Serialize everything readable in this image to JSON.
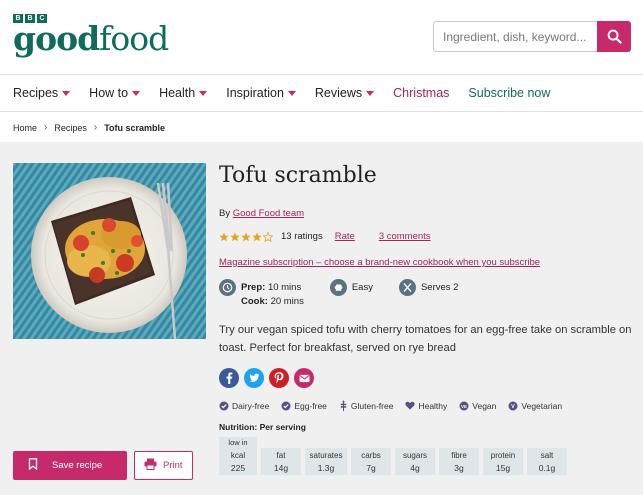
{
  "brand": {
    "bbc_letters": [
      "B",
      "B",
      "C"
    ],
    "name_bold": "good",
    "name_regular": "food",
    "accent": "#c72a6b",
    "brand_green": "#0f6b5c"
  },
  "search": {
    "placeholder": "Ingredient, dish, keyword...",
    "icon": "search-icon"
  },
  "nav": {
    "items": [
      {
        "label": "Recipes",
        "dropdown": true
      },
      {
        "label": "How to",
        "dropdown": true
      },
      {
        "label": "Health",
        "dropdown": true
      },
      {
        "label": "Inspiration",
        "dropdown": true
      },
      {
        "label": "Reviews",
        "dropdown": true
      },
      {
        "label": "Christmas",
        "dropdown": false
      },
      {
        "label": "Subscribe now",
        "dropdown": false
      }
    ]
  },
  "breadcrumb": {
    "items": [
      "Home",
      "Recipes",
      "Tofu scramble"
    ],
    "separator": "›"
  },
  "recipe": {
    "title": "Tofu scramble",
    "by_prefix": "By",
    "author": "Good Food team",
    "rating_stars": 4,
    "rating_max": 5,
    "ratings_count": "13 ratings",
    "rate_label": "Rate",
    "comments_label": "3 comments",
    "promo": "Magazine subscription – choose a brand-new cookbook when you subscribe",
    "prep_label": "Prep:",
    "prep_value": "10 mins",
    "cook_label": "Cook:",
    "cook_value": "20 mins",
    "difficulty": "Easy",
    "serves": "Serves 2",
    "description": "Try our vegan spiced tofu with cherry tomatoes for an egg-free take on scramble on toast. Perfect for breakfast, served on rye bread"
  },
  "social": [
    "facebook-icon",
    "twitter-icon",
    "pinterest-icon",
    "email-icon"
  ],
  "diet": [
    "Dairy-free",
    "Egg-free",
    "Gluten-free",
    "Healthy",
    "Vegan",
    "Vegetarian"
  ],
  "nutrition": {
    "title": "Nutrition: Per serving",
    "columns": [
      {
        "tag": "low in",
        "label": "kcal",
        "value": "225"
      },
      {
        "tag": "",
        "label": "fat",
        "value": "14g"
      },
      {
        "tag": "",
        "label": "saturates",
        "value": "1.3g"
      },
      {
        "tag": "",
        "label": "carbs",
        "value": "7g"
      },
      {
        "tag": "",
        "label": "sugars",
        "value": "4g"
      },
      {
        "tag": "",
        "label": "fibre",
        "value": "3g"
      },
      {
        "tag": "",
        "label": "protein",
        "value": "15g"
      },
      {
        "tag": "",
        "label": "salt",
        "value": "0.1g"
      }
    ]
  },
  "actions": {
    "save_label": "Save recipe",
    "print_label": "Print"
  }
}
